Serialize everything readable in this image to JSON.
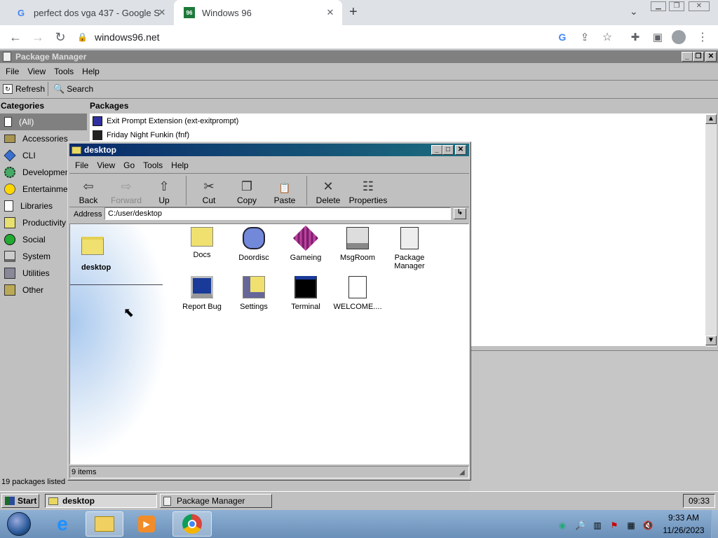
{
  "browser": {
    "tabs": [
      {
        "title": "perfect dos vga 437 - Google Se",
        "favicon": "G"
      },
      {
        "title": "Windows 96",
        "favicon": "96"
      }
    ],
    "new_tab": "+",
    "tab_dropdown": "⌄",
    "url": "windows96.net",
    "icons": [
      "back-arrow-icon",
      "forward-arrow-icon",
      "reload-icon",
      "lock-icon",
      "google-icon",
      "share-icon",
      "star-icon",
      "extensions-icon",
      "side-panel-icon",
      "profile-icon",
      "menu-icon"
    ]
  },
  "pkg": {
    "title": "Package Manager",
    "menu": [
      "File",
      "View",
      "Tools",
      "Help"
    ],
    "toolbar": {
      "refresh": "Refresh",
      "search": "Search"
    },
    "categories_header": "Categories",
    "packages_header": "Packages",
    "categories": [
      "(All)",
      "Accessories",
      "CLI",
      "Development",
      "Entertainment",
      "Libraries",
      "Productivity",
      "Social",
      "System",
      "Utilities",
      "Other"
    ],
    "packages": [
      "Exit Prompt Extension (ext-exitprompt)",
      "Friday Night Funkin (fnf)"
    ],
    "status": "19 packages listed"
  },
  "explorer": {
    "title": "desktop",
    "menu": [
      "File",
      "View",
      "Go",
      "Tools",
      "Help"
    ],
    "toolbar": [
      {
        "label": "Back",
        "glyph": "⇦",
        "enabled": true
      },
      {
        "label": "Forward",
        "glyph": "⇨",
        "enabled": false
      },
      {
        "label": "Up",
        "glyph": "⇧",
        "enabled": true
      },
      {
        "label": "Cut",
        "glyph": "✂",
        "enabled": true
      },
      {
        "label": "Copy",
        "glyph": "❐",
        "enabled": true
      },
      {
        "label": "Paste",
        "glyph": "📋",
        "enabled": true
      },
      {
        "label": "Delete",
        "glyph": "✕",
        "enabled": true
      },
      {
        "label": "Properties",
        "glyph": "☷",
        "enabled": true
      }
    ],
    "address_label": "Address",
    "address": "C:/user/desktop",
    "folder_name": "desktop",
    "items": [
      {
        "name": "Docs"
      },
      {
        "name": "Doordisc"
      },
      {
        "name": "Gameing"
      },
      {
        "name": "MsgRoom"
      },
      {
        "name": "Package Manager"
      },
      {
        "name": "Report Bug"
      },
      {
        "name": "Settings"
      },
      {
        "name": "Terminal"
      },
      {
        "name": "WELCOME...."
      }
    ],
    "status": "9 items"
  },
  "taskbar": {
    "start": "Start",
    "tasks": [
      "desktop",
      "Package Manager"
    ],
    "clock": "09:33"
  },
  "win7": {
    "time": "9:33 AM",
    "date": "11/26/2023"
  },
  "colors": {
    "w96_gray": "#c0c0c0",
    "title_active": "#0a2a6a",
    "title_inactive": "#808080",
    "chrome_tabstrip": "#dee1e6"
  }
}
